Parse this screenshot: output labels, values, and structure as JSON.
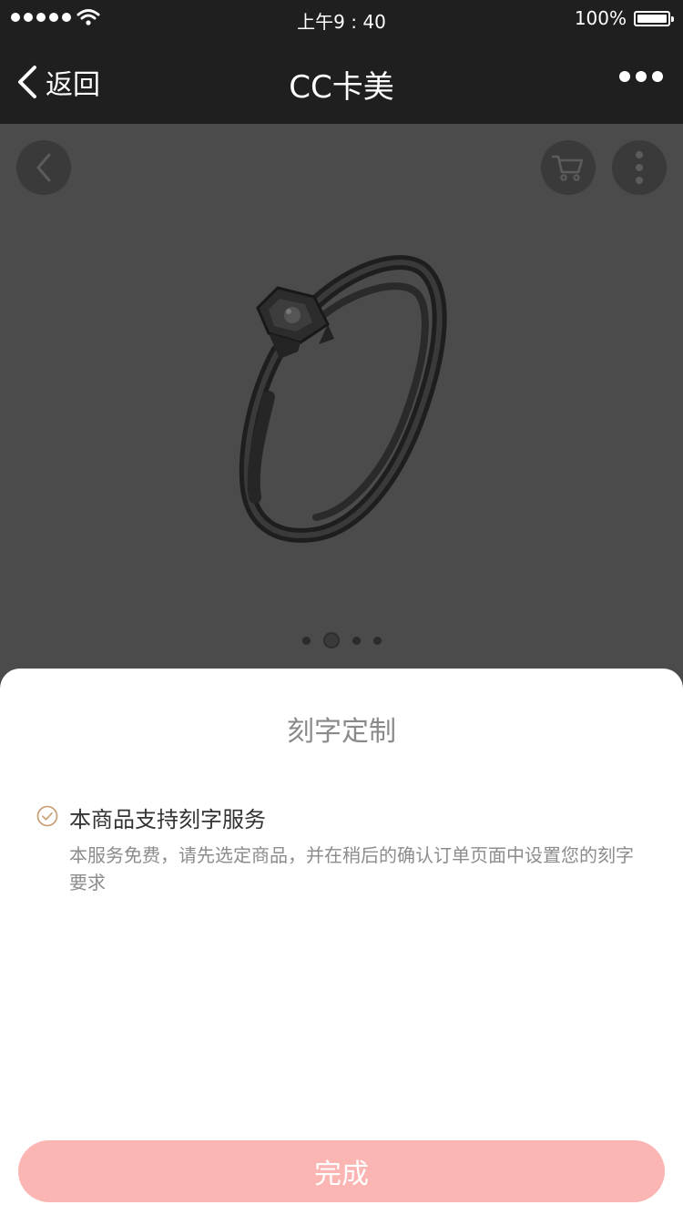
{
  "status_bar": {
    "time": "上午9 : 40",
    "battery_percent": "100%",
    "signal_bars": 5,
    "battery_level": 1.0
  },
  "nav": {
    "back_label": "返回",
    "title": "CC卡美",
    "more_icon": "ellipsis-icon"
  },
  "product": {
    "image_icon": "diamond-ring-image",
    "carousel_page_count": 4,
    "carousel_active_index": 1
  },
  "sheet": {
    "title": "刻字定制",
    "feature_title": "本商品支持刻字服务",
    "feature_desc": "本服务免费，请先选定商品，并在稍后的确认订单页面中设置您的刻字要求",
    "done_label": "完成"
  },
  "colors": {
    "accent_check": "#c9a27a",
    "done_button": "#fbb5b3",
    "nav_bg": "#1f1f1f"
  }
}
